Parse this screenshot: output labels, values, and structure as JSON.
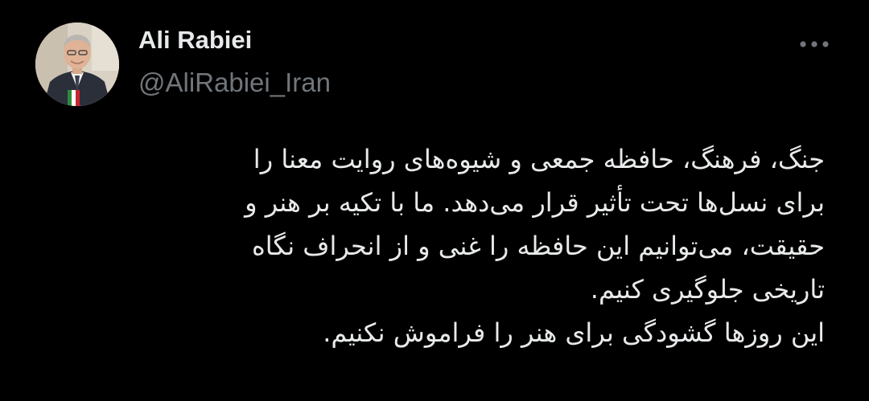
{
  "author": {
    "display_name": "Ali Rabiei",
    "handle": "@AliRabiei_Iran",
    "avatar": "profile-photo"
  },
  "more_icon": "more-horizontal-icon",
  "tweet": {
    "lines": [
      "جنگ، فرهنگ، حافظه جمعی و شیوه‌های روایت معنا را",
      "برای نسل‌ها تحت تأثیر قرار می‌دهد. ما با تکیه بر هنر و",
      "حقیقت، می‌توانیم این حافظه را غنی و از انحراف نگاه",
      "تاریخی جلوگیری کنیم.",
      "این روزها گشودگی برای هنر را فراموش نکنیم."
    ]
  },
  "colors": {
    "background": "#000000",
    "primary_text": "#e7e9ea",
    "secondary_text": "#71767b"
  }
}
